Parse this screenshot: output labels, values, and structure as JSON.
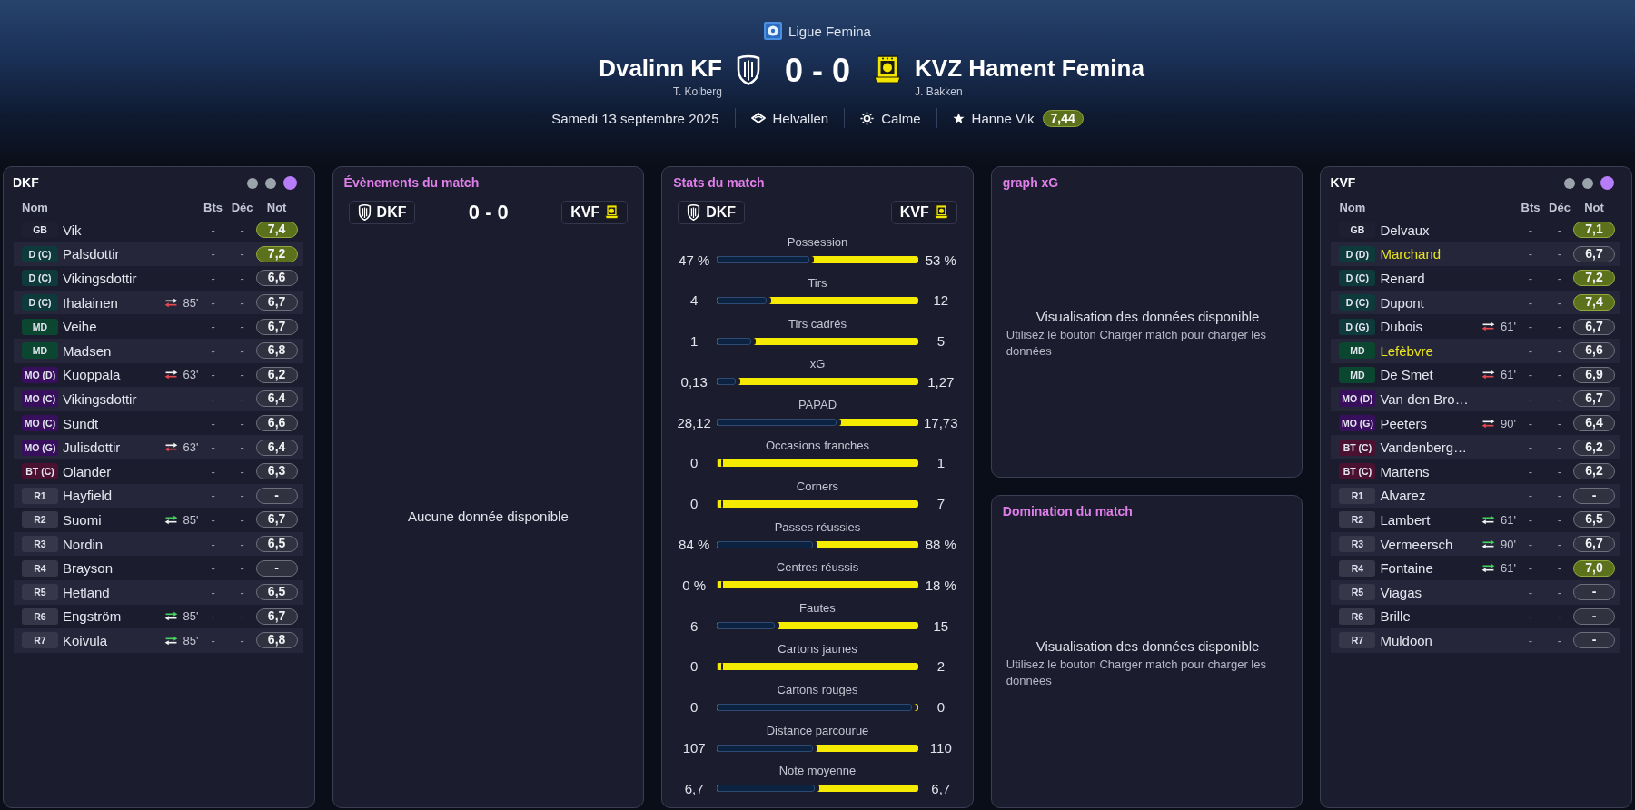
{
  "header": {
    "league": "Ligue Femina",
    "home": {
      "name": "Dvalinn KF",
      "coach": "T. Kolberg"
    },
    "score": "0 - 0",
    "away": {
      "name": "KVZ Hament Femina",
      "coach": "J. Bakken"
    },
    "date": "Samedi 13 septembre 2025",
    "stadium": "Helvallen",
    "weather": "Calme",
    "best_player": {
      "name": "Hanne Vik",
      "rating": "7,44"
    }
  },
  "home_roster": {
    "title": "DKF",
    "view_dots": [
      {
        "selected": false
      },
      {
        "selected": false
      },
      {
        "selected": true
      }
    ],
    "columns": [
      "Nom",
      "Bts",
      "Déc",
      "Not"
    ],
    "players": [
      {
        "position": "GB",
        "color": "#1e2031",
        "name": "Vik",
        "highlighted": false,
        "goals": "-",
        "decisions": "-",
        "rating": "7,4",
        "rating_good": true
      },
      {
        "position": "D (C)",
        "color": "#0e3a3c",
        "name": "Palsdottir",
        "highlighted": false,
        "goals": "-",
        "decisions": "-",
        "rating": "7,2",
        "rating_good": true
      },
      {
        "position": "D (C)",
        "color": "#0e3a3c",
        "name": "Vikingsdottir",
        "highlighted": false,
        "goals": "-",
        "decisions": "-",
        "rating": "6,6",
        "rating_good": false
      },
      {
        "position": "D (C)",
        "color": "#0e3a3c",
        "name": "Ihalainen",
        "highlighted": false,
        "sub": {
          "kind": "off",
          "minute": "85'"
        },
        "goals": "-",
        "decisions": "-",
        "rating": "6,7",
        "rating_good": false
      },
      {
        "position": "MD",
        "color": "#0b4630",
        "name": "Veihe",
        "highlighted": false,
        "goals": "-",
        "decisions": "-",
        "rating": "6,7",
        "rating_good": false
      },
      {
        "position": "MD",
        "color": "#0b4630",
        "name": "Madsen",
        "highlighted": false,
        "goals": "-",
        "decisions": "-",
        "rating": "6,8",
        "rating_good": false
      },
      {
        "position": "MO (D)",
        "color": "#380f5c",
        "name": "Kuoppala",
        "highlighted": false,
        "sub": {
          "kind": "off",
          "minute": "63'"
        },
        "goals": "-",
        "decisions": "-",
        "rating": "6,2",
        "rating_good": false
      },
      {
        "position": "MO (C)",
        "color": "#380f5c",
        "name": "Vikingsdottir",
        "highlighted": false,
        "goals": "-",
        "decisions": "-",
        "rating": "6,4",
        "rating_good": false
      },
      {
        "position": "MO (C)",
        "color": "#380f5c",
        "name": "Sundt",
        "highlighted": false,
        "goals": "-",
        "decisions": "-",
        "rating": "6,6",
        "rating_good": false
      },
      {
        "position": "MO (G)",
        "color": "#380f5c",
        "name": "Julisdottir",
        "highlighted": false,
        "sub": {
          "kind": "off",
          "minute": "63'"
        },
        "goals": "-",
        "decisions": "-",
        "rating": "6,4",
        "rating_good": false
      },
      {
        "position": "BT (C)",
        "color": "#4a1230",
        "name": "Olander",
        "highlighted": false,
        "goals": "-",
        "decisions": "-",
        "rating": "6,3",
        "rating_good": false
      },
      {
        "position": "R1",
        "color": "#363849",
        "name": "Hayfield",
        "highlighted": false,
        "goals": "-",
        "decisions": "-",
        "rating": "-",
        "rating_good": false
      },
      {
        "position": "R2",
        "color": "#363849",
        "name": "Suomi",
        "highlighted": false,
        "sub": {
          "kind": "on",
          "minute": "85'"
        },
        "goals": "-",
        "decisions": "-",
        "rating": "6,7",
        "rating_good": false
      },
      {
        "position": "R3",
        "color": "#363849",
        "name": "Nordin",
        "highlighted": false,
        "goals": "-",
        "decisions": "-",
        "rating": "6,5",
        "rating_good": false
      },
      {
        "position": "R4",
        "color": "#363849",
        "name": "Brayson",
        "highlighted": false,
        "goals": "-",
        "decisions": "-",
        "rating": "-",
        "rating_good": false
      },
      {
        "position": "R5",
        "color": "#363849",
        "name": "Hetland",
        "highlighted": false,
        "goals": "-",
        "decisions": "-",
        "rating": "6,5",
        "rating_good": false
      },
      {
        "position": "R6",
        "color": "#363849",
        "name": "Engström",
        "highlighted": false,
        "sub": {
          "kind": "on",
          "minute": "85'"
        },
        "goals": "-",
        "decisions": "-",
        "rating": "6,7",
        "rating_good": false
      },
      {
        "position": "R7",
        "color": "#363849",
        "name": "Koivula",
        "highlighted": false,
        "sub": {
          "kind": "on",
          "minute": "85'"
        },
        "goals": "-",
        "decisions": "-",
        "rating": "6,8",
        "rating_good": false
      }
    ]
  },
  "events": {
    "title": "Évènements du match",
    "home_tag": "DKF",
    "score": "0 - 0",
    "away_tag": "KVF",
    "empty_text": "Aucune donnée disponible"
  },
  "stats": {
    "title": "Stats du match",
    "home_tag": "DKF",
    "away_tag": "KVF",
    "rows": [
      {
        "label": "Possession",
        "home": "47 %",
        "away": "53 %",
        "level": 0.47
      },
      {
        "label": "Tirs",
        "home": "4",
        "away": "12",
        "level": 0.25
      },
      {
        "label": "Tirs cadrés",
        "home": "1",
        "away": "5",
        "level": 0.17
      },
      {
        "label": "xG",
        "home": "0,13",
        "away": "1,27",
        "level": 0.09
      },
      {
        "label": "PAPAD",
        "home": "28,12",
        "away": "17,73",
        "level": 0.61
      },
      {
        "label": "Occasions franches",
        "home": "0",
        "away": "1",
        "level": 0
      },
      {
        "label": "Corners",
        "home": "0",
        "away": "7",
        "level": 0
      },
      {
        "label": "Passes réussies",
        "home": "84 %",
        "away": "88 %",
        "level": 0.49
      },
      {
        "label": "Centres réussis",
        "home": "0 %",
        "away": "18 %",
        "level": 0
      },
      {
        "label": "Fautes",
        "home": "6",
        "away": "15",
        "level": 0.29
      },
      {
        "label": "Cartons jaunes",
        "home": "0",
        "away": "2",
        "level": 0
      },
      {
        "label": "Cartons rouges",
        "home": "0",
        "away": "0",
        "level": 1
      },
      {
        "label": "Distance parcourue",
        "home": "107",
        "away": "110",
        "level": 0.49
      },
      {
        "label": "Note moyenne",
        "home": "6,7",
        "away": "6,7",
        "level": 0.5
      }
    ]
  },
  "xg_graph": {
    "title": "graph xG",
    "message": "Visualisation des données disponible",
    "hint": "Utilisez le bouton Charger match pour charger les données"
  },
  "domination": {
    "title": "Domination du match",
    "message": "Visualisation des données disponible",
    "hint": "Utilisez le bouton Charger match pour charger les données"
  },
  "away_roster": {
    "title": "KVF",
    "view_dots": [
      {
        "selected": false
      },
      {
        "selected": false
      },
      {
        "selected": true
      }
    ],
    "columns": [
      "Nom",
      "Bts",
      "Déc",
      "Not"
    ],
    "players": [
      {
        "position": "GB",
        "color": "#1e2031",
        "name": "Delvaux",
        "highlighted": false,
        "goals": "-",
        "decisions": "-",
        "rating": "7,1",
        "rating_good": true
      },
      {
        "position": "D (D)",
        "color": "#0e3a3c",
        "name": "Marchand",
        "highlighted": true,
        "goals": "-",
        "decisions": "-",
        "rating": "6,7",
        "rating_good": false
      },
      {
        "position": "D (C)",
        "color": "#0e3a3c",
        "name": "Renard",
        "highlighted": false,
        "goals": "-",
        "decisions": "-",
        "rating": "7,2",
        "rating_good": true
      },
      {
        "position": "D (C)",
        "color": "#0e3a3c",
        "name": "Dupont",
        "highlighted": false,
        "goals": "-",
        "decisions": "-",
        "rating": "7,4",
        "rating_good": true
      },
      {
        "position": "D (G)",
        "color": "#0e3a3c",
        "name": "Dubois",
        "highlighted": false,
        "sub": {
          "kind": "off",
          "minute": "61'"
        },
        "goals": "-",
        "decisions": "-",
        "rating": "6,7",
        "rating_good": false
      },
      {
        "position": "MD",
        "color": "#0b4630",
        "name": "Lefèbvre",
        "highlighted": true,
        "goals": "-",
        "decisions": "-",
        "rating": "6,6",
        "rating_good": false
      },
      {
        "position": "MD",
        "color": "#0b4630",
        "name": "De Smet",
        "highlighted": false,
        "sub": {
          "kind": "off",
          "minute": "61'"
        },
        "goals": "-",
        "decisions": "-",
        "rating": "6,9",
        "rating_good": false
      },
      {
        "position": "MO (D)",
        "color": "#380f5c",
        "name": "Van den Bro…",
        "highlighted": false,
        "goals": "-",
        "decisions": "-",
        "rating": "6,7",
        "rating_good": false
      },
      {
        "position": "MO (G)",
        "color": "#380f5c",
        "name": "Peeters",
        "highlighted": false,
        "sub": {
          "kind": "off",
          "minute": "90'"
        },
        "goals": "-",
        "decisions": "-",
        "rating": "6,4",
        "rating_good": false
      },
      {
        "position": "BT (C)",
        "color": "#4a1230",
        "name": "Vandenberg…",
        "highlighted": false,
        "goals": "-",
        "decisions": "-",
        "rating": "6,2",
        "rating_good": false
      },
      {
        "position": "BT (C)",
        "color": "#4a1230",
        "name": "Martens",
        "highlighted": false,
        "goals": "-",
        "decisions": "-",
        "rating": "6,2",
        "rating_good": false
      },
      {
        "position": "R1",
        "color": "#363849",
        "name": "Alvarez",
        "highlighted": false,
        "goals": "-",
        "decisions": "-",
        "rating": "-",
        "rating_good": false
      },
      {
        "position": "R2",
        "color": "#363849",
        "name": "Lambert",
        "highlighted": false,
        "sub": {
          "kind": "on",
          "minute": "61'"
        },
        "goals": "-",
        "decisions": "-",
        "rating": "6,5",
        "rating_good": false
      },
      {
        "position": "R3",
        "color": "#363849",
        "name": "Vermeersch",
        "highlighted": false,
        "sub": {
          "kind": "on",
          "minute": "90'"
        },
        "goals": "-",
        "decisions": "-",
        "rating": "6,7",
        "rating_good": false
      },
      {
        "position": "R4",
        "color": "#363849",
        "name": "Fontaine",
        "highlighted": false,
        "sub": {
          "kind": "on",
          "minute": "61'"
        },
        "goals": "-",
        "decisions": "-",
        "rating": "7,0",
        "rating_good": true
      },
      {
        "position": "R5",
        "color": "#363849",
        "name": "Viagas",
        "highlighted": false,
        "goals": "-",
        "decisions": "-",
        "rating": "-",
        "rating_good": false
      },
      {
        "position": "R6",
        "color": "#363849",
        "name": "Brille",
        "highlighted": false,
        "goals": "-",
        "decisions": "-",
        "rating": "-",
        "rating_good": false
      },
      {
        "position": "R7",
        "color": "#363849",
        "name": "Muldoon",
        "highlighted": false,
        "goals": "-",
        "decisions": "-",
        "rating": "-",
        "rating_good": false
      }
    ]
  }
}
